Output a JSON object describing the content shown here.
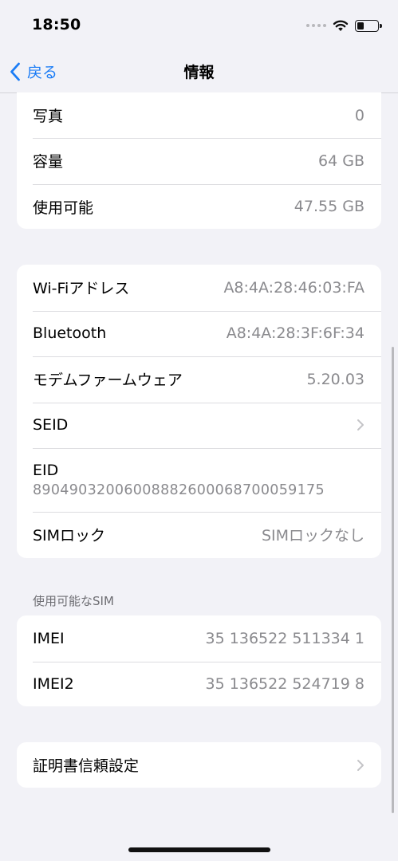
{
  "status": {
    "time": "18:50"
  },
  "nav": {
    "back_label": "戻る",
    "title": "情報"
  },
  "group1": [
    {
      "label": "写真",
      "value": "0"
    },
    {
      "label": "容量",
      "value": "64 GB"
    },
    {
      "label": "使用可能",
      "value": "47.55 GB"
    }
  ],
  "group2": {
    "wifi": {
      "label": "Wi-Fiアドレス",
      "value": "A8:4A:28:46:03:FA"
    },
    "bluetooth": {
      "label": "Bluetooth",
      "value": "A8:4A:28:3F:6F:34"
    },
    "modem": {
      "label": "モデムファームウェア",
      "value": "5.20.03"
    },
    "seid": {
      "label": "SEID"
    },
    "eid": {
      "label": "EID",
      "value": "89049032006008882600068700059175"
    },
    "simlock": {
      "label": "SIMロック",
      "value": "SIMロックなし"
    }
  },
  "sim_section": {
    "header": "使用可能なSIM",
    "imei": {
      "label": "IMEI",
      "value": "35 136522 511334 1"
    },
    "imei2": {
      "label": "IMEI2",
      "value": "35 136522 524719 8"
    }
  },
  "cert": {
    "label": "証明書信頼設定"
  }
}
